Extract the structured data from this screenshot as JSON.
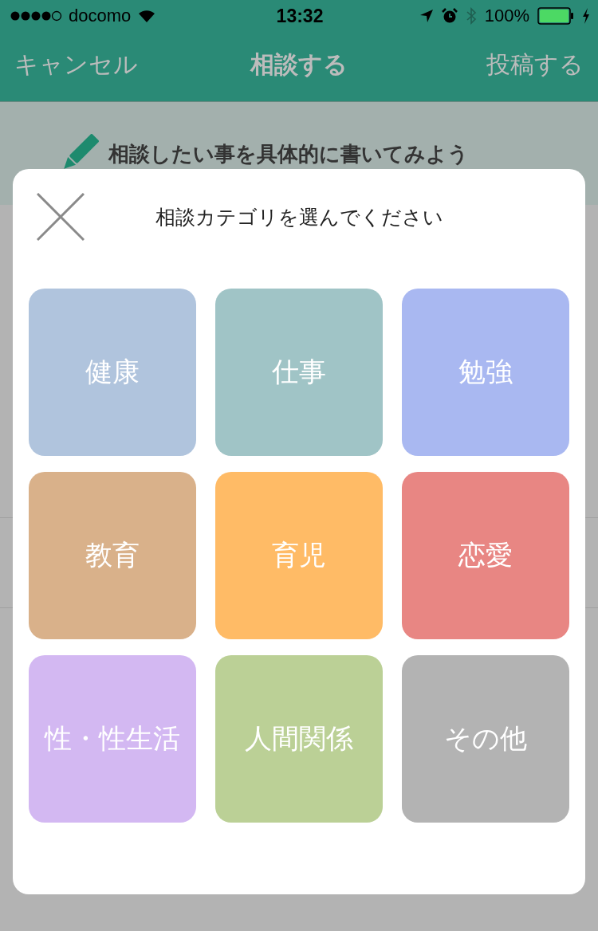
{
  "status_bar": {
    "carrier": "docomo",
    "time": "13:32",
    "battery": "100%"
  },
  "nav_bar": {
    "left": "キャンセル",
    "title": "相談する",
    "right": "投稿する"
  },
  "banner": {
    "text": "相談したい事を具体的に書いてみよう"
  },
  "modal": {
    "title": "相談カテゴリを選んでください",
    "categories": [
      {
        "label": "健康",
        "color": "#b0c4dd"
      },
      {
        "label": "仕事",
        "color": "#a0c4c6"
      },
      {
        "label": "勉強",
        "color": "#a9b8f1"
      },
      {
        "label": "教育",
        "color": "#d9b18a"
      },
      {
        "label": "育児",
        "color": "#ffbb66"
      },
      {
        "label": "恋愛",
        "color": "#e88683"
      },
      {
        "label": "性・性生活",
        "color": "#d3b8f2"
      },
      {
        "label": "人間関係",
        "color": "#bbd096"
      },
      {
        "label": "その他",
        "color": "#b3b3b3"
      }
    ]
  }
}
